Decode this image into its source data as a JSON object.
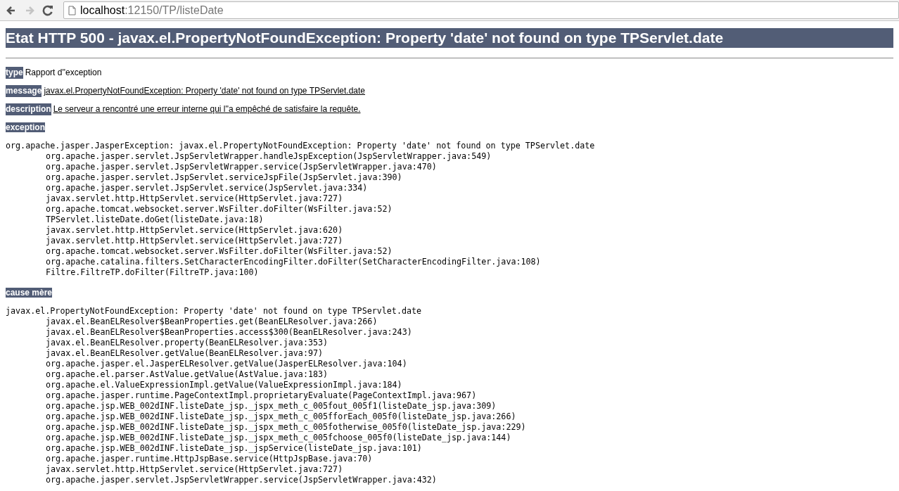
{
  "browser": {
    "nav_buttons": [
      {
        "kind": "back",
        "disabled": false
      },
      {
        "kind": "forward",
        "disabled": true
      },
      {
        "kind": "reload",
        "disabled": false
      }
    ],
    "address": {
      "host": "localhost",
      "path": ":12150/TP/listeDate"
    }
  },
  "heading": "Etat HTTP 500 - javax.el.PropertyNotFoundException: Property 'date' not found on type TPServlet.date",
  "fields": [
    {
      "label": "type",
      "value": "Rapport d''exception",
      "underlined": false
    },
    {
      "label": "message",
      "value": "javax.el.PropertyNotFoundException: Property 'date' not found on type TPServlet.date",
      "underlined": true
    },
    {
      "label": "description",
      "value": "Le serveur a rencontré une erreur interne qui l''a empêché de satisfaire la requête.",
      "underlined": true
    }
  ],
  "sections": [
    {
      "label": "exception",
      "head": "org.apache.jasper.JasperException: javax.el.PropertyNotFoundException: Property 'date' not found on type TPServlet.date",
      "frames": [
        "org.apache.jasper.servlet.JspServletWrapper.handleJspException(JspServletWrapper.java:549)",
        "org.apache.jasper.servlet.JspServletWrapper.service(JspServletWrapper.java:470)",
        "org.apache.jasper.servlet.JspServlet.serviceJspFile(JspServlet.java:390)",
        "org.apache.jasper.servlet.JspServlet.service(JspServlet.java:334)",
        "javax.servlet.http.HttpServlet.service(HttpServlet.java:727)",
        "org.apache.tomcat.websocket.server.WsFilter.doFilter(WsFilter.java:52)",
        "TPServlet.listeDate.doGet(listeDate.java:18)",
        "javax.servlet.http.HttpServlet.service(HttpServlet.java:620)",
        "javax.servlet.http.HttpServlet.service(HttpServlet.java:727)",
        "org.apache.tomcat.websocket.server.WsFilter.doFilter(WsFilter.java:52)",
        "org.apache.catalina.filters.SetCharacterEncodingFilter.doFilter(SetCharacterEncodingFilter.java:108)",
        "Filtre.FiltreTP.doFilter(FiltreTP.java:100)"
      ]
    },
    {
      "label": "cause mère",
      "head": "javax.el.PropertyNotFoundException: Property 'date' not found on type TPServlet.date",
      "frames": [
        "javax.el.BeanELResolver$BeanProperties.get(BeanELResolver.java:266)",
        "javax.el.BeanELResolver$BeanProperties.access$300(BeanELResolver.java:243)",
        "javax.el.BeanELResolver.property(BeanELResolver.java:353)",
        "javax.el.BeanELResolver.getValue(BeanELResolver.java:97)",
        "org.apache.jasper.el.JasperELResolver.getValue(JasperELResolver.java:104)",
        "org.apache.el.parser.AstValue.getValue(AstValue.java:183)",
        "org.apache.el.ValueExpressionImpl.getValue(ValueExpressionImpl.java:184)",
        "org.apache.jasper.runtime.PageContextImpl.proprietaryEvaluate(PageContextImpl.java:967)",
        "org.apache.jsp.WEB_002dINF.listeDate_jsp._jspx_meth_c_005fout_005f1(listeDate_jsp.java:309)",
        "org.apache.jsp.WEB_002dINF.listeDate_jsp._jspx_meth_c_005fforEach_005f0(listeDate_jsp.java:266)",
        "org.apache.jsp.WEB_002dINF.listeDate_jsp._jspx_meth_c_005fotherwise_005f0(listeDate_jsp.java:229)",
        "org.apache.jsp.WEB_002dINF.listeDate_jsp._jspx_meth_c_005fchoose_005f0(listeDate_jsp.java:144)",
        "org.apache.jsp.WEB_002dINF.listeDate_jsp._jspService(listeDate_jsp.java:101)",
        "org.apache.jasper.runtime.HttpJspBase.service(HttpJspBase.java:70)",
        "javax.servlet.http.HttpServlet.service(HttpServlet.java:727)",
        "org.apache.jasper.servlet.JspServletWrapper.service(JspServletWrapper.java:432)"
      ]
    }
  ]
}
